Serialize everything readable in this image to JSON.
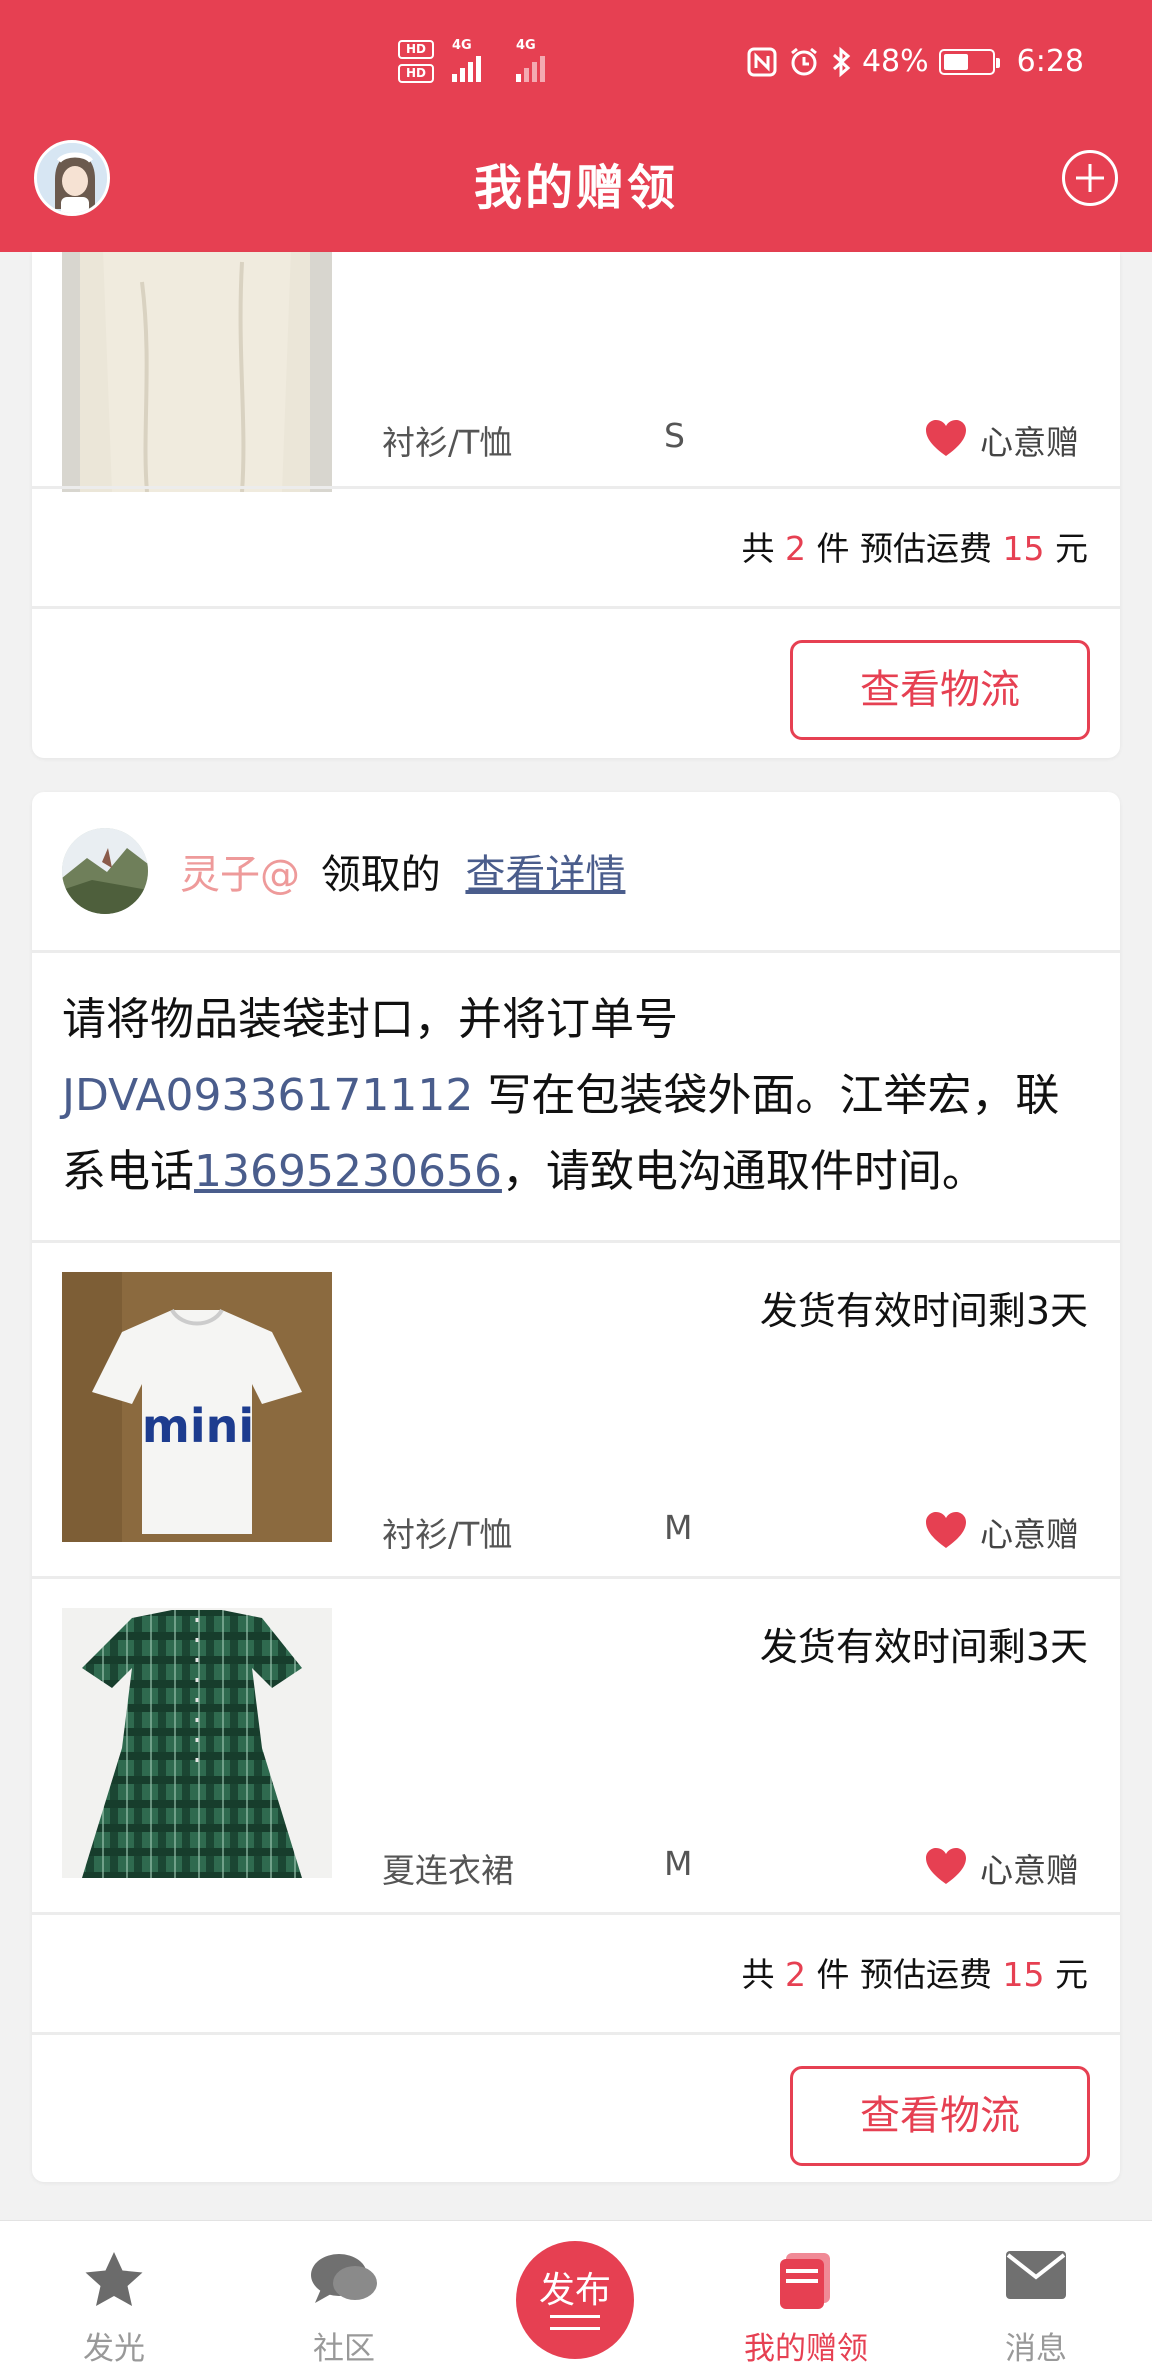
{
  "status_bar": {
    "hd1": "HD",
    "hd2": "HD",
    "net1": "4G",
    "net2": "4G",
    "battery_pct": "48%",
    "time": "6:28"
  },
  "header": {
    "title": "我的赠领"
  },
  "card1": {
    "item": {
      "category": "衬衫/T恤",
      "size": "S",
      "gift_label": "心意赠"
    },
    "summary": {
      "prefix": "共",
      "count": "2",
      "count_unit": "件",
      "fee_label": "预估运费",
      "fee": "15",
      "fee_unit": "元"
    },
    "logistics_btn": "查看物流"
  },
  "card2": {
    "claimer": "灵子@",
    "claimed_text": "领取的",
    "details_link": "查看详情",
    "instruction": {
      "part1": "请将物品装袋封口，并将订单号 ",
      "order_no": "JDVA09336171112",
      "part2": " 写在包装袋外面。江举宏，联系电话",
      "phone": "13695230656",
      "part3": "，请致电沟通取件时间。"
    },
    "items": [
      {
        "deadline": "发货有效时间剩3天",
        "category": "衬衫/T恤",
        "size": "M",
        "gift_label": "心意赠"
      },
      {
        "deadline": "发货有效时间剩3天",
        "category": "夏连衣裙",
        "size": "M",
        "gift_label": "心意赠"
      }
    ],
    "summary": {
      "prefix": "共",
      "count": "2",
      "count_unit": "件",
      "fee_label": "预估运费",
      "fee": "15",
      "fee_unit": "元"
    },
    "logistics_btn": "查看物流"
  },
  "nav": {
    "tabs": [
      {
        "label": "发光",
        "icon": "star-icon"
      },
      {
        "label": "社区",
        "icon": "chat-bubbles-icon"
      },
      {
        "label": "发布",
        "icon": "publish-icon"
      },
      {
        "label": "我的赠领",
        "icon": "gift-box-icon",
        "active": true
      },
      {
        "label": "消息",
        "icon": "envelope-icon"
      }
    ]
  },
  "colors": {
    "brand": "#e64052",
    "link": "#4a5d8c",
    "username": "#ee9a9a"
  }
}
